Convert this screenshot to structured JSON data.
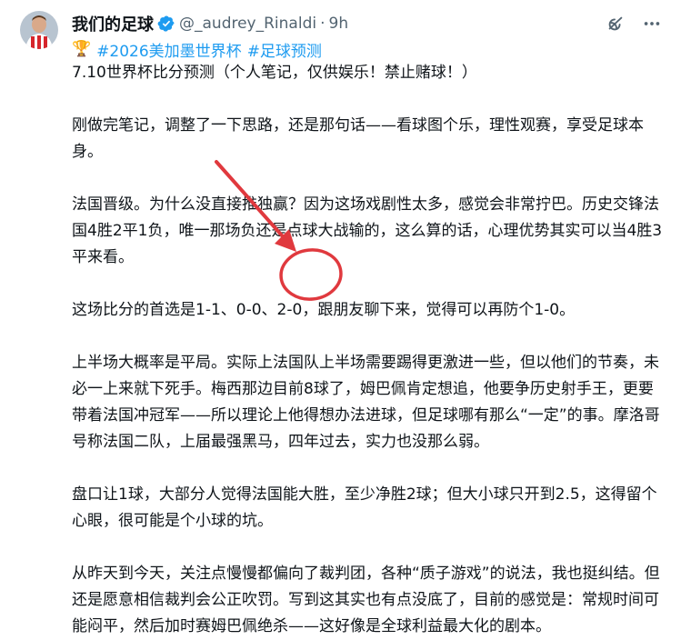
{
  "author": {
    "display_name": "我们的足球",
    "handle": "@_audrey_Rinaldi",
    "separator": "·",
    "time": "9h"
  },
  "icons": {
    "verified": "verified-badge-icon",
    "grok": "grok-icon",
    "more": "more-options-icon",
    "trophy": "trophy-icon"
  },
  "hashtags": {
    "trophy": "🏆",
    "tag1": "#2026美加墨世界杯",
    "tag2": "#足球预测"
  },
  "post": {
    "p1": "7.10世界杯比分预测（个人笔记，仅供娱乐！禁止赌球！）",
    "p2": "刚做完笔记，调整了一下思路，还是那句话——看球图个乐，理性观赛，享受足球本身。",
    "p3": "法国晋级。为什么没直接推独赢？因为这场戏剧性太多，感觉会非常拧巴。历史交锋法国4胜2平1负，唯一那场负还是点球大战输的，这么算的话，心理优势其实可以当4胜3平来看。",
    "p4_a": "这场比分的首选是1-1、0-0、",
    "p4_highlight": "2-0",
    "p4_b": "，跟朋友聊下来，觉得可以再防个1-0。",
    "p5": "上半场大概率是平局。实际上法国队上半场需要踢得更激进一些，但以他们的节奏，未必一上来就下死手。梅西那边目前8球了，姆巴佩肯定想追，他要争历史射手王，更要带着法国冲冠军——所以理论上他得想办法进球，但足球哪有那么“一定”的事。摩洛哥号称法国二队，上届最强黑马，四年过去，实力也没那么弱。",
    "p6": "盘口让1球，大部分人觉得法国能大胜，至少净胜2球；但大小球只开到2.5，这得留个心眼，很可能是个小球的坑。",
    "p7": "从昨天到今天，关注点慢慢都偏向了裁判团，各种“质子游戏”的说法，我也挺纠结。但还是愿意相信裁判会公正吹罚。写到这其实也有点没底了，目前的感觉是：常规时间可能闷平，然后加时赛姆巴佩绝杀——这好像是全球利益最大化的剧本。"
  },
  "colors": {
    "text": "#0f1419",
    "secondary": "#536471",
    "link": "#1d9bf0",
    "verified": "#1d9bf0",
    "annotation": "#e0393e"
  }
}
